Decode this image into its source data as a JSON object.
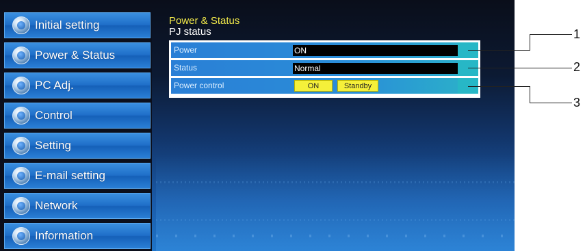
{
  "sidebar": {
    "items": [
      {
        "label": "Initial setting"
      },
      {
        "label": "Power & Status"
      },
      {
        "label": "PC Adj."
      },
      {
        "label": "Control"
      },
      {
        "label": "Setting"
      },
      {
        "label": "E-mail setting"
      },
      {
        "label": "Network"
      },
      {
        "label": "Information"
      }
    ]
  },
  "header": {
    "section_title": "Power & Status",
    "sub_title": "PJ status"
  },
  "status": {
    "power_label": "Power",
    "power_value": "ON",
    "status_label": "Status",
    "status_value": "Normal",
    "power_control_label": "Power control",
    "on_button": "ON",
    "standby_button": "Standby"
  },
  "callouts": [
    "1",
    "2",
    "3"
  ],
  "colors": {
    "title_yellow": "#f2e94a",
    "button_yellow": "#f5f03a",
    "nav_blue": "#2a7fd6",
    "accent_cyan": "#27b7c6"
  }
}
